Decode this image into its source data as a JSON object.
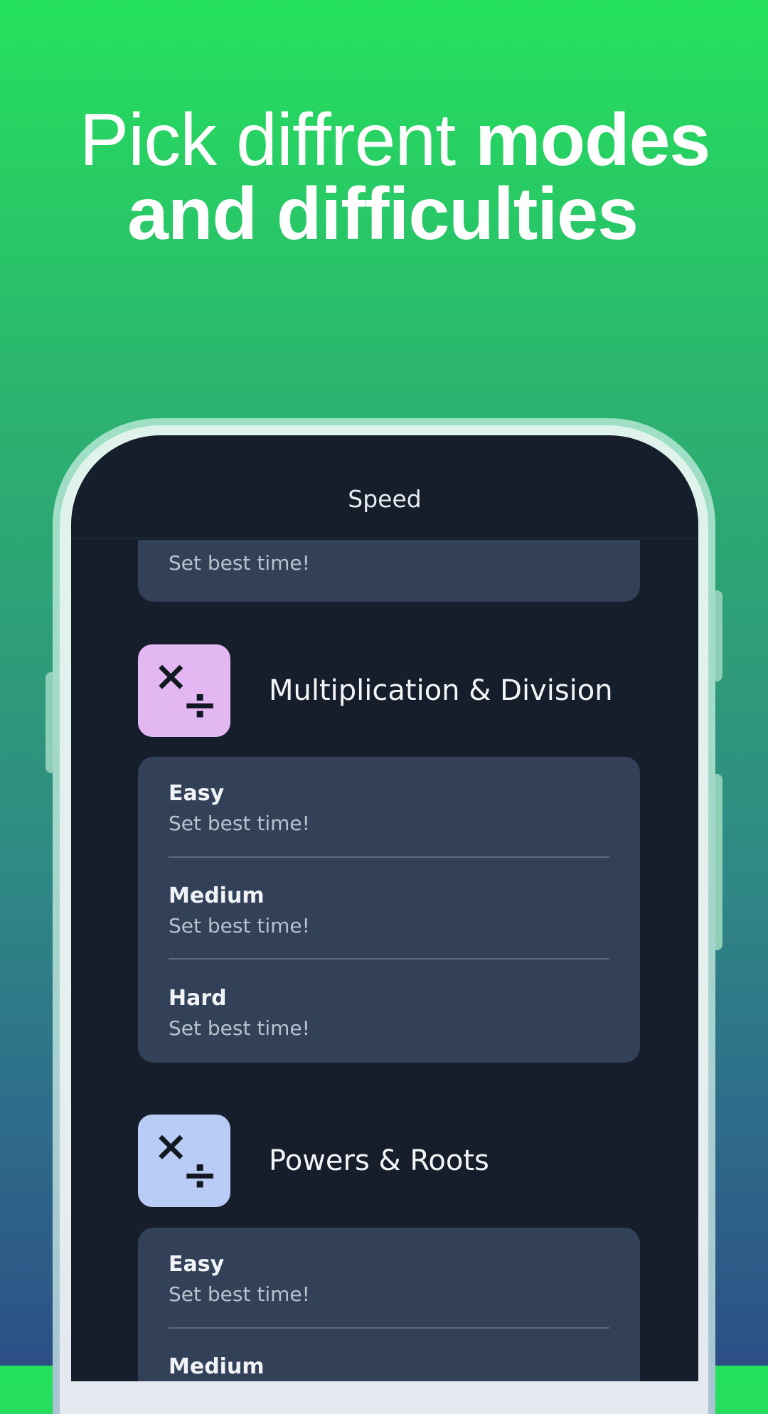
{
  "headline": {
    "part_light": "Pick diffrent",
    "part_bold": "modes",
    "line2": "and difficulties"
  },
  "app": {
    "title": "Speed",
    "top_partial": {
      "subtitle": "Set best time!"
    },
    "sections": [
      {
        "title": "Multiplication & Division",
        "icon": "multiply-divide-icon",
        "icon_color": "#e3b8f2",
        "levels": [
          {
            "name": "Easy",
            "status": "Set best time!"
          },
          {
            "name": "Medium",
            "status": "Set best time!"
          },
          {
            "name": "Hard",
            "status": "Set best time!"
          }
        ]
      },
      {
        "title": "Powers & Roots",
        "icon": "multiply-divide-icon",
        "icon_color": "#b9ccf6",
        "levels": [
          {
            "name": "Easy",
            "status": "Set best time!"
          },
          {
            "name": "Medium",
            "status": ""
          }
        ]
      }
    ]
  },
  "colors": {
    "screen_bg": "#161e2b",
    "card_bg": "#324158",
    "gradient_top": "#25e25c",
    "gradient_bottom": "#2c4f86"
  }
}
